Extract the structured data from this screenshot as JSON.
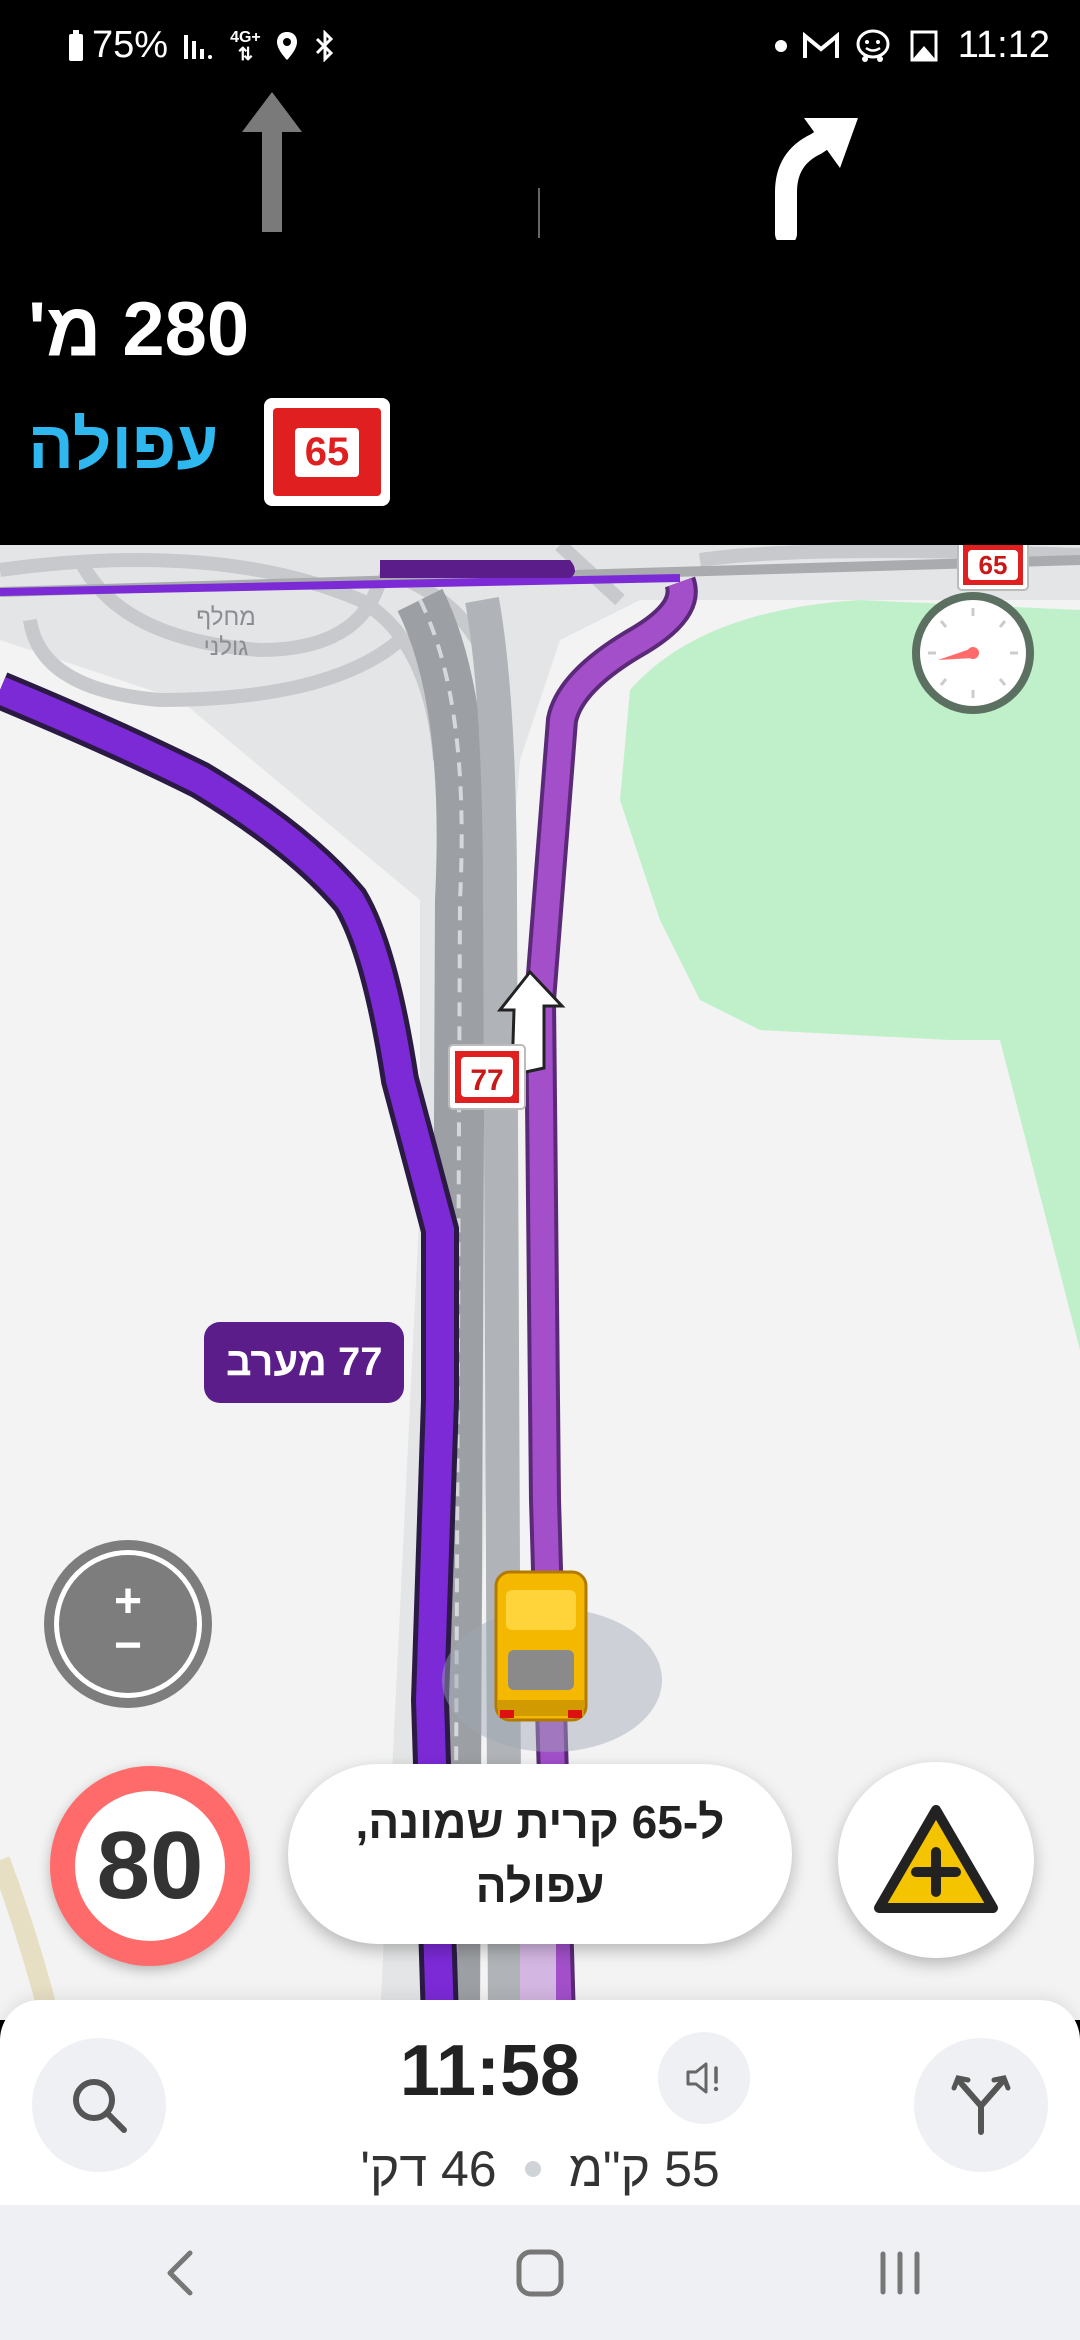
{
  "status_bar": {
    "battery_percent": "75%",
    "network": "4G+",
    "time": "11:12",
    "icons": [
      "battery-icon",
      "signal-icon",
      "data-arrows-icon",
      "location-icon",
      "bluetooth-icon",
      "dot-icon",
      "gmail-icon",
      "waze-icon",
      "gallery-icon"
    ]
  },
  "navigation": {
    "distance": "280 מ'",
    "street": "עפולה",
    "route_number": "65",
    "lanes": [
      "straight-arrow-icon",
      "turn-right-arrow-icon"
    ]
  },
  "map": {
    "interchange_label_line1": "מחלף",
    "interchange_label_line2": "גולני",
    "road_shield_77": "77",
    "road_shield_65": "65",
    "road_label": "77 מערב"
  },
  "overlays": {
    "speed_limit": "80",
    "next_instruction": "ל-65 קרית שמונה, עפולה"
  },
  "eta_bar": {
    "arrival_time": "11:58",
    "distance_remaining": "55 ק\"מ",
    "time_remaining": "46 דק'"
  },
  "colors": {
    "route_purple": "#7b2ad6",
    "route_light_purple": "#a24fc9",
    "park_green": "#bff0c9",
    "street_blue": "#2fb8f0",
    "speed_red": "#ff6b6b",
    "warning_yellow": "#f5c400"
  }
}
